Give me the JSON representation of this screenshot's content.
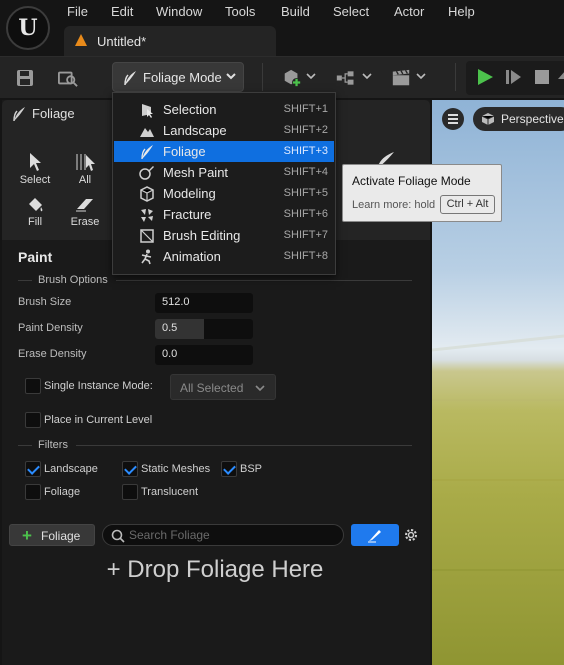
{
  "menubar": {
    "items": [
      "File",
      "Edit",
      "Window",
      "Tools",
      "Build",
      "Select",
      "Actor",
      "Help"
    ]
  },
  "document_tab": {
    "label": "Untitled*"
  },
  "toolbar": {
    "mode_label": "Foliage Mode"
  },
  "panel": {
    "tab_label": "Foliage",
    "tools": [
      {
        "label": "Select",
        "icon": "cursor-icon"
      },
      {
        "label": "All",
        "icon": "select-all-icon"
      },
      {
        "label": "Fill",
        "icon": "paint-bucket-icon"
      },
      {
        "label": "Erase",
        "icon": "eraser-icon"
      }
    ],
    "section_title": "Paint",
    "brush_options_label": "Brush Options",
    "brush_size": {
      "label": "Brush Size",
      "value": "512.0"
    },
    "paint_density": {
      "label": "Paint Density",
      "value": "0.5",
      "fraction": 0.5
    },
    "erase_density": {
      "label": "Erase Density",
      "value": "0.0"
    },
    "single_instance": {
      "label": "Single Instance Mode:",
      "checked": false,
      "dropdown_value": "All Selected"
    },
    "place_current_level": {
      "label": "Place in Current Level",
      "checked": false
    },
    "filters_label": "Filters",
    "filters": [
      {
        "label": "Landscape",
        "checked": true
      },
      {
        "label": "Static Meshes",
        "checked": true
      },
      {
        "label": "BSP",
        "checked": true
      },
      {
        "label": "Foliage",
        "checked": false
      },
      {
        "label": "Translucent",
        "checked": false
      }
    ],
    "add_button_label": "Foliage",
    "search_placeholder": "Search Foliage",
    "drop_text": "+ Drop Foliage Here"
  },
  "viewport": {
    "perspective_label": "Perspective"
  },
  "mode_menu": {
    "items": [
      {
        "label": "Selection",
        "shortcut": "SHIFT+1",
        "icon": "selection-mode-icon",
        "active": false
      },
      {
        "label": "Landscape",
        "shortcut": "SHIFT+2",
        "icon": "landscape-mode-icon",
        "active": false
      },
      {
        "label": "Foliage",
        "shortcut": "SHIFT+3",
        "icon": "foliage-mode-icon",
        "active": true
      },
      {
        "label": "Mesh Paint",
        "shortcut": "SHIFT+4",
        "icon": "mesh-paint-mode-icon",
        "active": false
      },
      {
        "label": "Modeling",
        "shortcut": "SHIFT+5",
        "icon": "modeling-mode-icon",
        "active": false
      },
      {
        "label": "Fracture",
        "shortcut": "SHIFT+6",
        "icon": "fracture-mode-icon",
        "active": false
      },
      {
        "label": "Brush Editing",
        "shortcut": "SHIFT+7",
        "icon": "brush-editing-mode-icon",
        "active": false
      },
      {
        "label": "Animation",
        "shortcut": "SHIFT+8",
        "icon": "animation-mode-icon",
        "active": false
      }
    ]
  },
  "tooltip": {
    "title": "Activate Foliage Mode",
    "learn_more": "Learn more: hold",
    "key_combo": "Ctrl + Alt"
  },
  "colors": {
    "accent": "#0f6fe0",
    "checkbox_check": "#2b8cff",
    "play_green": "#4cc24c",
    "tab_orange": "#e88a1a"
  }
}
